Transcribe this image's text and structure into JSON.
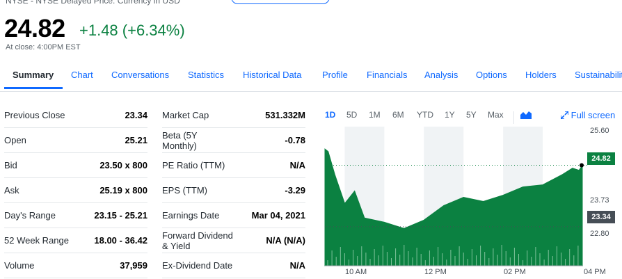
{
  "header": {
    "exchange_note": "NYSE - NYSE Delayed Price. Currency in USD",
    "price": "24.82",
    "change": "+1.48 (+6.34%)",
    "close_note": "At close: 4:00PM EST"
  },
  "tabs": [
    {
      "label": "Summary"
    },
    {
      "label": "Chart"
    },
    {
      "label": "Conversations"
    },
    {
      "label": "Statistics"
    },
    {
      "label": "Historical Data"
    },
    {
      "label": "Profile"
    },
    {
      "label": "Financials"
    },
    {
      "label": "Analysis"
    },
    {
      "label": "Options"
    },
    {
      "label": "Holders"
    },
    {
      "label": "Sustainability"
    }
  ],
  "stats_left": [
    {
      "label": "Previous Close",
      "value": "23.34"
    },
    {
      "label": "Open",
      "value": "25.21"
    },
    {
      "label": "Bid",
      "value": "23.50 x 800"
    },
    {
      "label": "Ask",
      "value": "25.19 x 800"
    },
    {
      "label": "Day's Range",
      "value": "23.15 - 25.21"
    },
    {
      "label": "52 Week Range",
      "value": "18.00 - 36.42"
    },
    {
      "label": "Volume",
      "value": "37,959"
    }
  ],
  "stats_right": [
    {
      "label": "Market Cap",
      "value": "531.332M"
    },
    {
      "label": "Beta (5Y Monthly)",
      "value": "-0.78"
    },
    {
      "label": "PE Ratio (TTM)",
      "value": "N/A"
    },
    {
      "label": "EPS (TTM)",
      "value": "-3.29"
    },
    {
      "label": "Earnings Date",
      "value": "Mar 04, 2021"
    },
    {
      "label": "Forward Dividend & Yield",
      "value": "N/A (N/A)"
    },
    {
      "label": "Ex-Dividend Date",
      "value": "N/A"
    }
  ],
  "chart": {
    "ranges": [
      "1D",
      "5D",
      "1M",
      "6M",
      "YTD",
      "1Y",
      "5Y",
      "Max"
    ],
    "active_range": "1D",
    "fullscreen_label": "Full screen",
    "y_labels": [
      "25.60",
      "23.73",
      "22.80"
    ],
    "current_tag": "24.82",
    "prev_close_tag": "23.34",
    "x_labels": [
      "10 AM",
      "12 PM",
      "02 PM",
      "04 PM"
    ],
    "colors": {
      "fill": "#0b8141",
      "accent": "#0f69ff",
      "shade": "#f0f3f5"
    }
  },
  "chart_data": {
    "type": "area",
    "x": [
      "09:30",
      "09:35",
      "09:45",
      "10:00",
      "10:15",
      "10:30",
      "11:00",
      "11:30",
      "12:00",
      "12:30",
      "13:00",
      "13:30",
      "14:00",
      "14:30",
      "15:00",
      "15:30",
      "15:45",
      "15:55",
      "16:00"
    ],
    "y": [
      25.21,
      25.15,
      24.6,
      23.9,
      24.2,
      23.55,
      23.45,
      23.3,
      23.5,
      23.85,
      24.05,
      23.95,
      24.1,
      24.3,
      24.35,
      24.6,
      24.75,
      24.7,
      24.82
    ],
    "ylim": [
      22.4,
      25.75
    ],
    "y_ticks": [
      25.6,
      24.82,
      23.73,
      23.34,
      22.8
    ],
    "x_ticks": [
      "10 AM",
      "12 PM",
      "02 PM",
      "04 PM"
    ]
  }
}
